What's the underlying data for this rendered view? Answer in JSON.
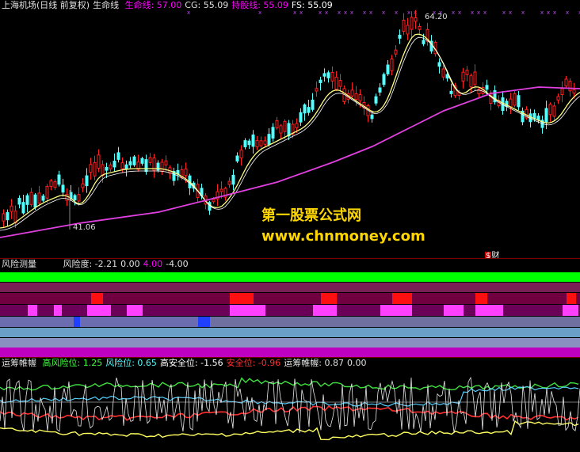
{
  "main": {
    "title": "上海机场(日线 前复权)",
    "indicator_name": "生命线",
    "items": [
      {
        "label": "生命线:",
        "value": "57.00",
        "color": "#ff00ff"
      },
      {
        "label": "CG:",
        "value": "55.09",
        "color": "#e0e0e0"
      },
      {
        "label": "持股线:",
        "value": "55.09",
        "color": "#ff00ff"
      },
      {
        "label": "FS:",
        "value": "55.09",
        "color": "#ffffff"
      }
    ],
    "high_label": "64.20",
    "low_label": "41.06",
    "event_label": "财",
    "colors": {
      "up": "#ff2020",
      "down": "#54ffff",
      "lifeline": "#e040e0",
      "ma": "#ffff80",
      "ma2": "#ffffff"
    }
  },
  "watermark": {
    "line1": "第一股票公式网",
    "line2": "www.chnmoney.com"
  },
  "risk": {
    "title": "风险测量",
    "items": [
      {
        "label": "风险度:",
        "value": "-2.21",
        "color": "#e0e0e0"
      },
      {
        "label": "",
        "value": "0.00",
        "color": "#e0e0e0"
      },
      {
        "label": "",
        "value": "4.00",
        "color": "#ff00ff"
      },
      {
        "label": "",
        "value": "-4.00",
        "color": "#e0e0e0"
      }
    ]
  },
  "osc": {
    "title": "运筹帷幄",
    "items": [
      {
        "label": "高风险位:",
        "value": "1.25",
        "color": "#40ff40"
      },
      {
        "label": "风险位:",
        "value": "0.65",
        "color": "#54ffff"
      },
      {
        "label": "高安全位:",
        "value": "-1.56",
        "color": "#ffffff"
      },
      {
        "label": "安全位:",
        "value": "-0.96",
        "color": "#ff3030"
      },
      {
        "label": "运筹帷幄:",
        "value": "0.87",
        "color": "#e0e0e0"
      },
      {
        "label": "",
        "value": "0.00",
        "color": "#e0e0e0"
      }
    ]
  }
}
